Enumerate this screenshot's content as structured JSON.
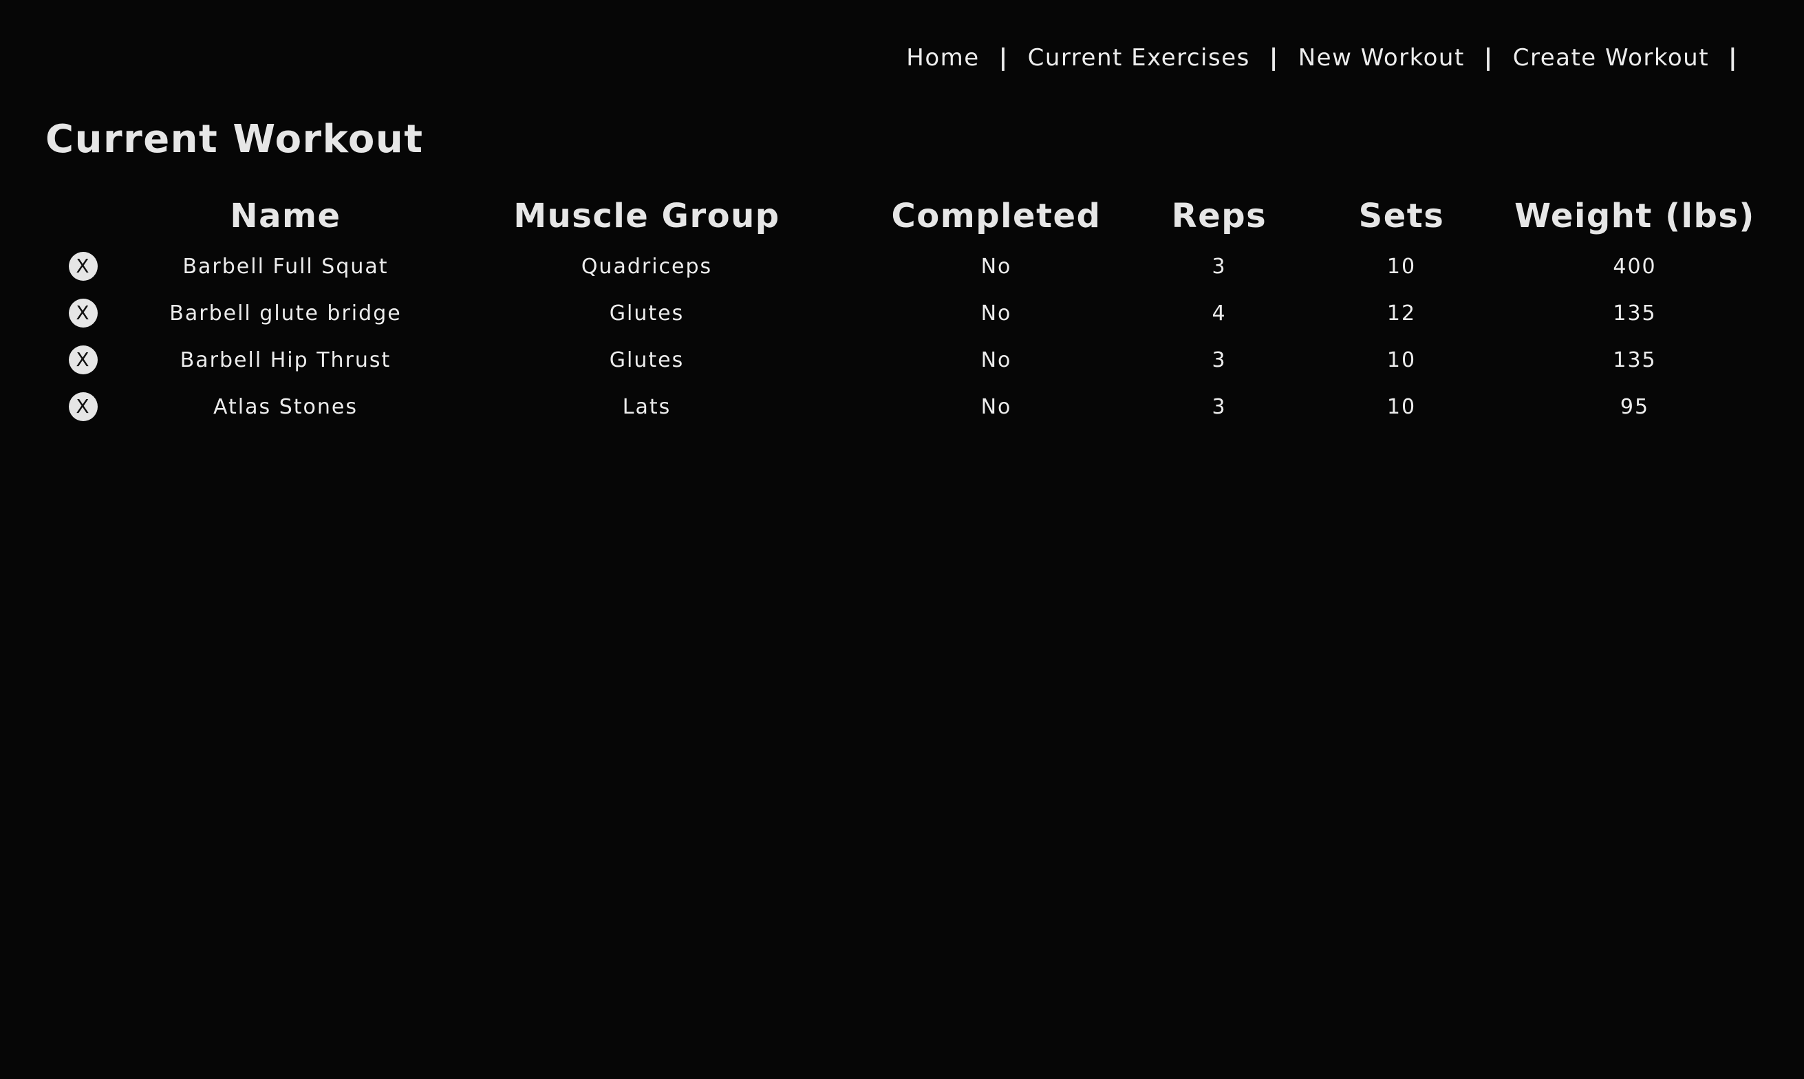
{
  "nav": {
    "items": [
      {
        "label": "Home",
        "name": "nav-home"
      },
      {
        "label": "Current Exercises",
        "name": "nav-current-exercises"
      },
      {
        "label": "New Workout",
        "name": "nav-new-workout"
      },
      {
        "label": "Create Workout",
        "name": "nav-create-workout"
      }
    ],
    "separator": "|"
  },
  "page": {
    "title": "Current Workout"
  },
  "table": {
    "headers": {
      "name": "Name",
      "muscle_group": "Muscle Group",
      "completed": "Completed",
      "reps": "Reps",
      "sets": "Sets",
      "weight": "Weight (lbs)"
    },
    "remove_icon": "X",
    "rows": [
      {
        "name": "Barbell Full Squat",
        "muscle_group": "Quadriceps",
        "completed": "No",
        "reps": "3",
        "sets": "10",
        "weight": "400"
      },
      {
        "name": "Barbell glute bridge",
        "muscle_group": "Glutes",
        "completed": "No",
        "reps": "4",
        "sets": "12",
        "weight": "135"
      },
      {
        "name": "Barbell Hip Thrust",
        "muscle_group": "Glutes",
        "completed": "No",
        "reps": "3",
        "sets": "10",
        "weight": "135"
      },
      {
        "name": "Atlas Stones",
        "muscle_group": "Lats",
        "completed": "No",
        "reps": "3",
        "sets": "10",
        "weight": "95"
      }
    ]
  }
}
